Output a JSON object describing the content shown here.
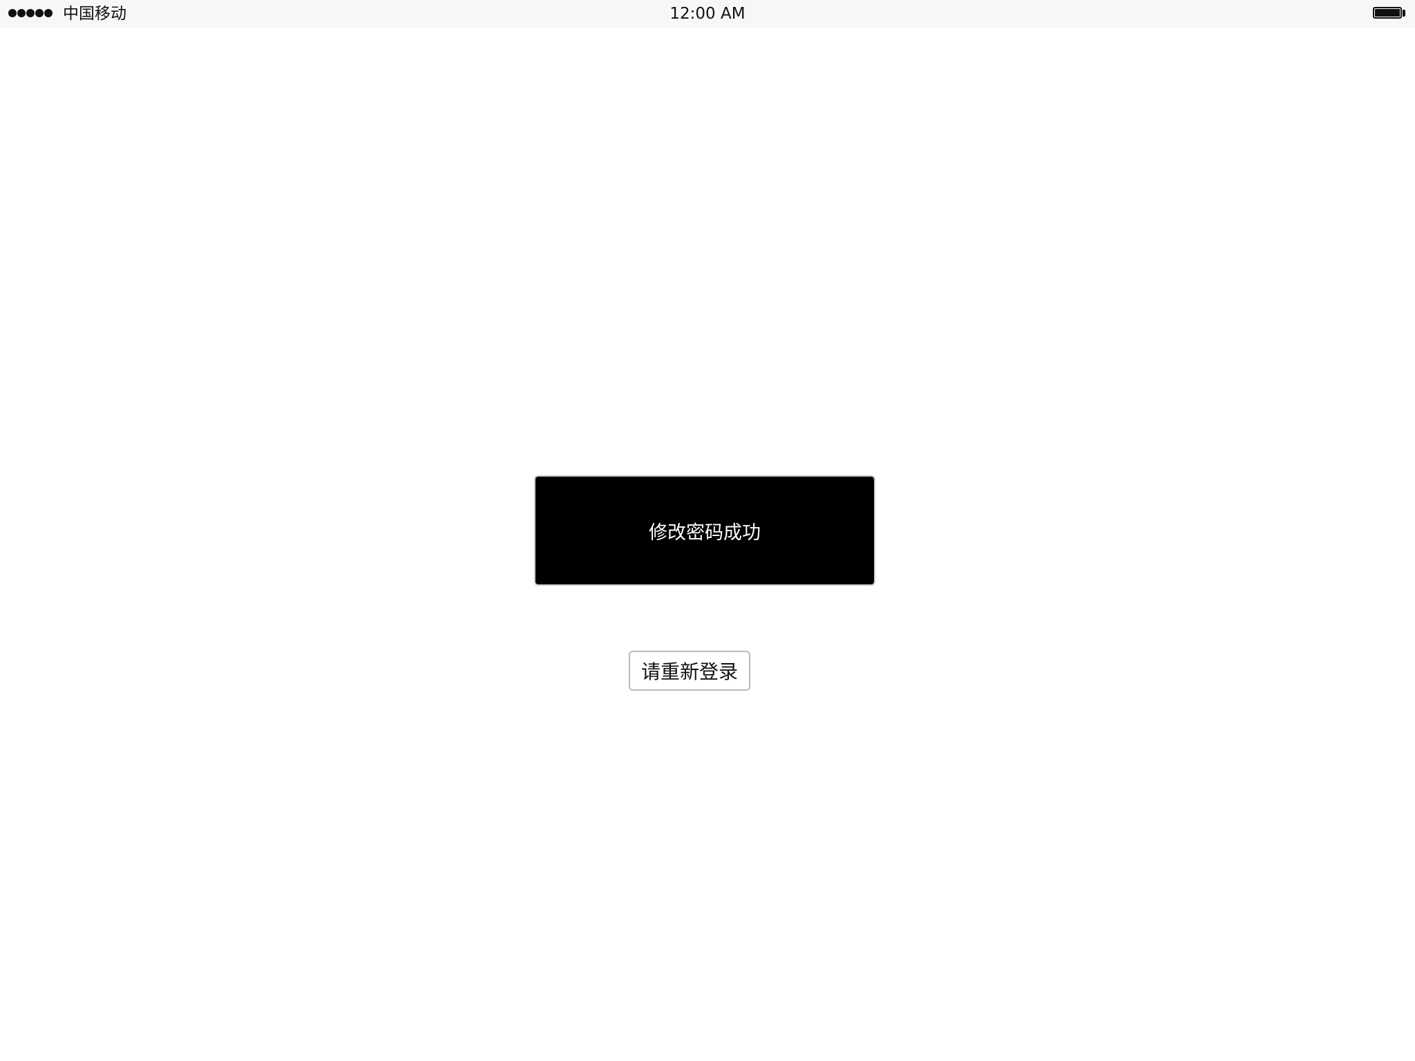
{
  "status_bar": {
    "carrier": "中国移动",
    "time": "12:00 AM",
    "signal_bars": 5,
    "battery_level": 1.0
  },
  "toast": {
    "message": "修改密码成功"
  },
  "actions": {
    "relogin_label": "请重新登录"
  }
}
